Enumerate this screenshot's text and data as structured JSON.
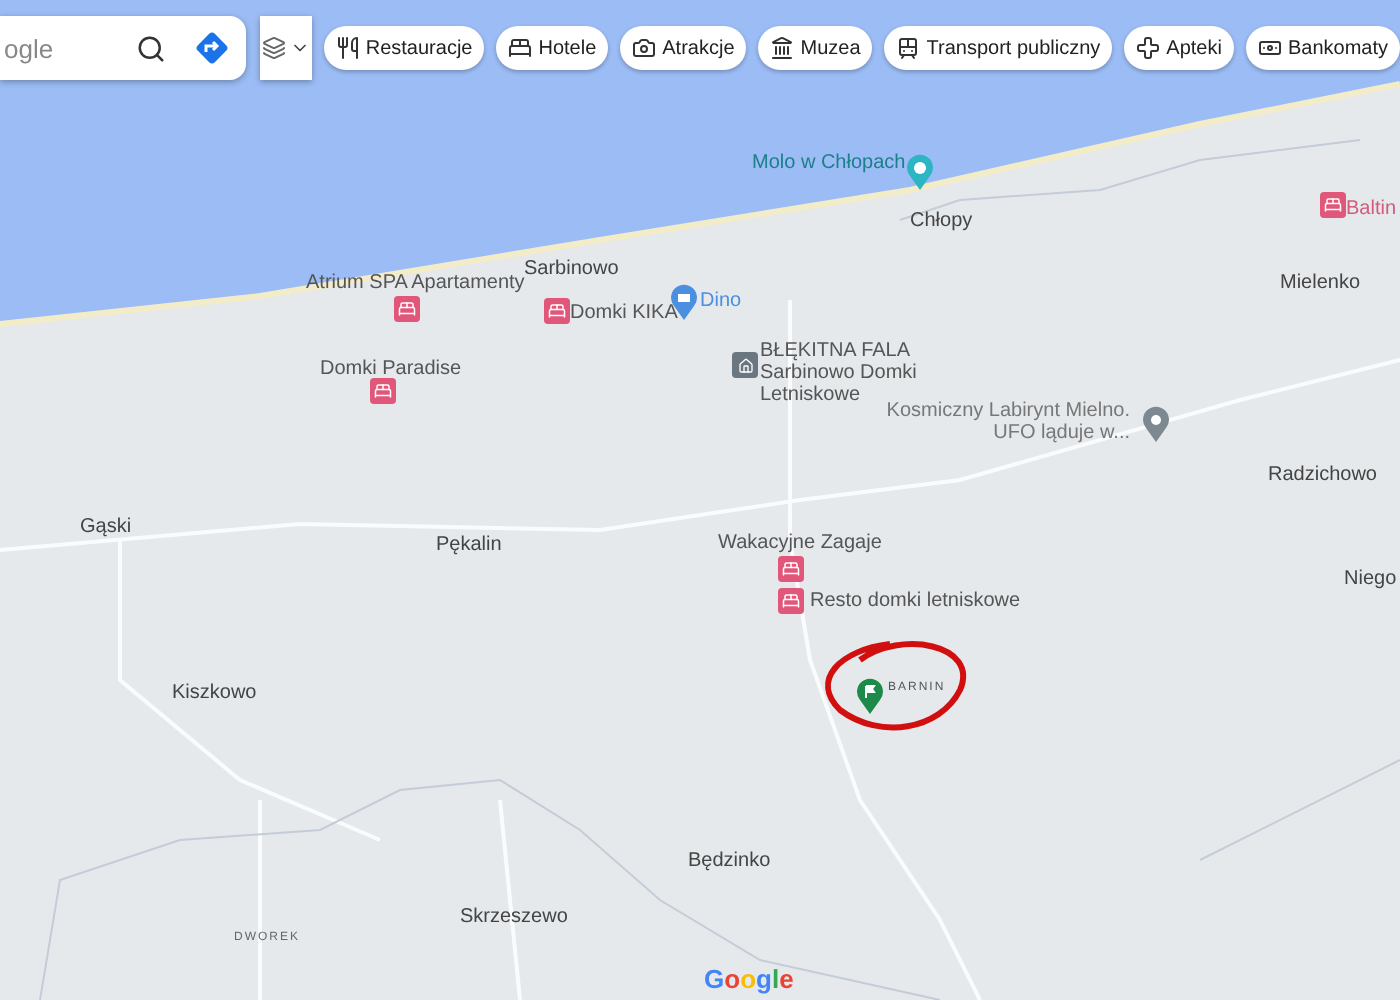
{
  "search": {
    "placeholder": "ogle"
  },
  "chips": [
    {
      "kind": "restaurant",
      "label": "Restauracje"
    },
    {
      "kind": "hotel",
      "label": "Hotele"
    },
    {
      "kind": "camera",
      "label": "Atrakcje"
    },
    {
      "kind": "museum",
      "label": "Muzea"
    },
    {
      "kind": "transit",
      "label": "Transport publiczny"
    },
    {
      "kind": "pharmacy",
      "label": "Apteki"
    },
    {
      "kind": "atm",
      "label": "Bankomaty"
    }
  ],
  "places": [
    {
      "kind": "attraction",
      "name": "Molo w Chłopach"
    },
    {
      "kind": "town",
      "name": "Chłopy"
    },
    {
      "kind": "hotel",
      "name": "Baltin"
    },
    {
      "kind": "hotel",
      "name": "Atrium SPA Apartamenty"
    },
    {
      "kind": "town",
      "name": "Sarbinowo"
    },
    {
      "kind": "hotel",
      "name": "Domki KIKA"
    },
    {
      "kind": "shop",
      "name": "Dino"
    },
    {
      "kind": "square",
      "name": "BŁĘKITNA FALA Sarbinowo Domki Letniskowe"
    },
    {
      "kind": "town",
      "name": "Mielenko"
    },
    {
      "kind": "hotel",
      "name": "Domki Paradise"
    },
    {
      "kind": "pin",
      "name": "Kosmiczny Labirynt Mielno. UFO ląduje w..."
    },
    {
      "kind": "town",
      "name": "Radzichowo"
    },
    {
      "kind": "town",
      "name": "Gąski"
    },
    {
      "kind": "town",
      "name": "Pękalin"
    },
    {
      "kind": "hotel",
      "name": "Wakacyjne Zagaje"
    },
    {
      "kind": "hotel",
      "name": "Resto domki letniskowe"
    },
    {
      "kind": "town",
      "name": "Niego"
    },
    {
      "kind": "town",
      "name": "Kiszkowo"
    },
    {
      "kind": "flag",
      "name": "BARNIN"
    },
    {
      "kind": "town",
      "name": "Będzinko"
    },
    {
      "kind": "town",
      "name": "Skrzeszewo"
    },
    {
      "kind": "area",
      "name": "DWOREK"
    }
  ],
  "logo": "Google"
}
